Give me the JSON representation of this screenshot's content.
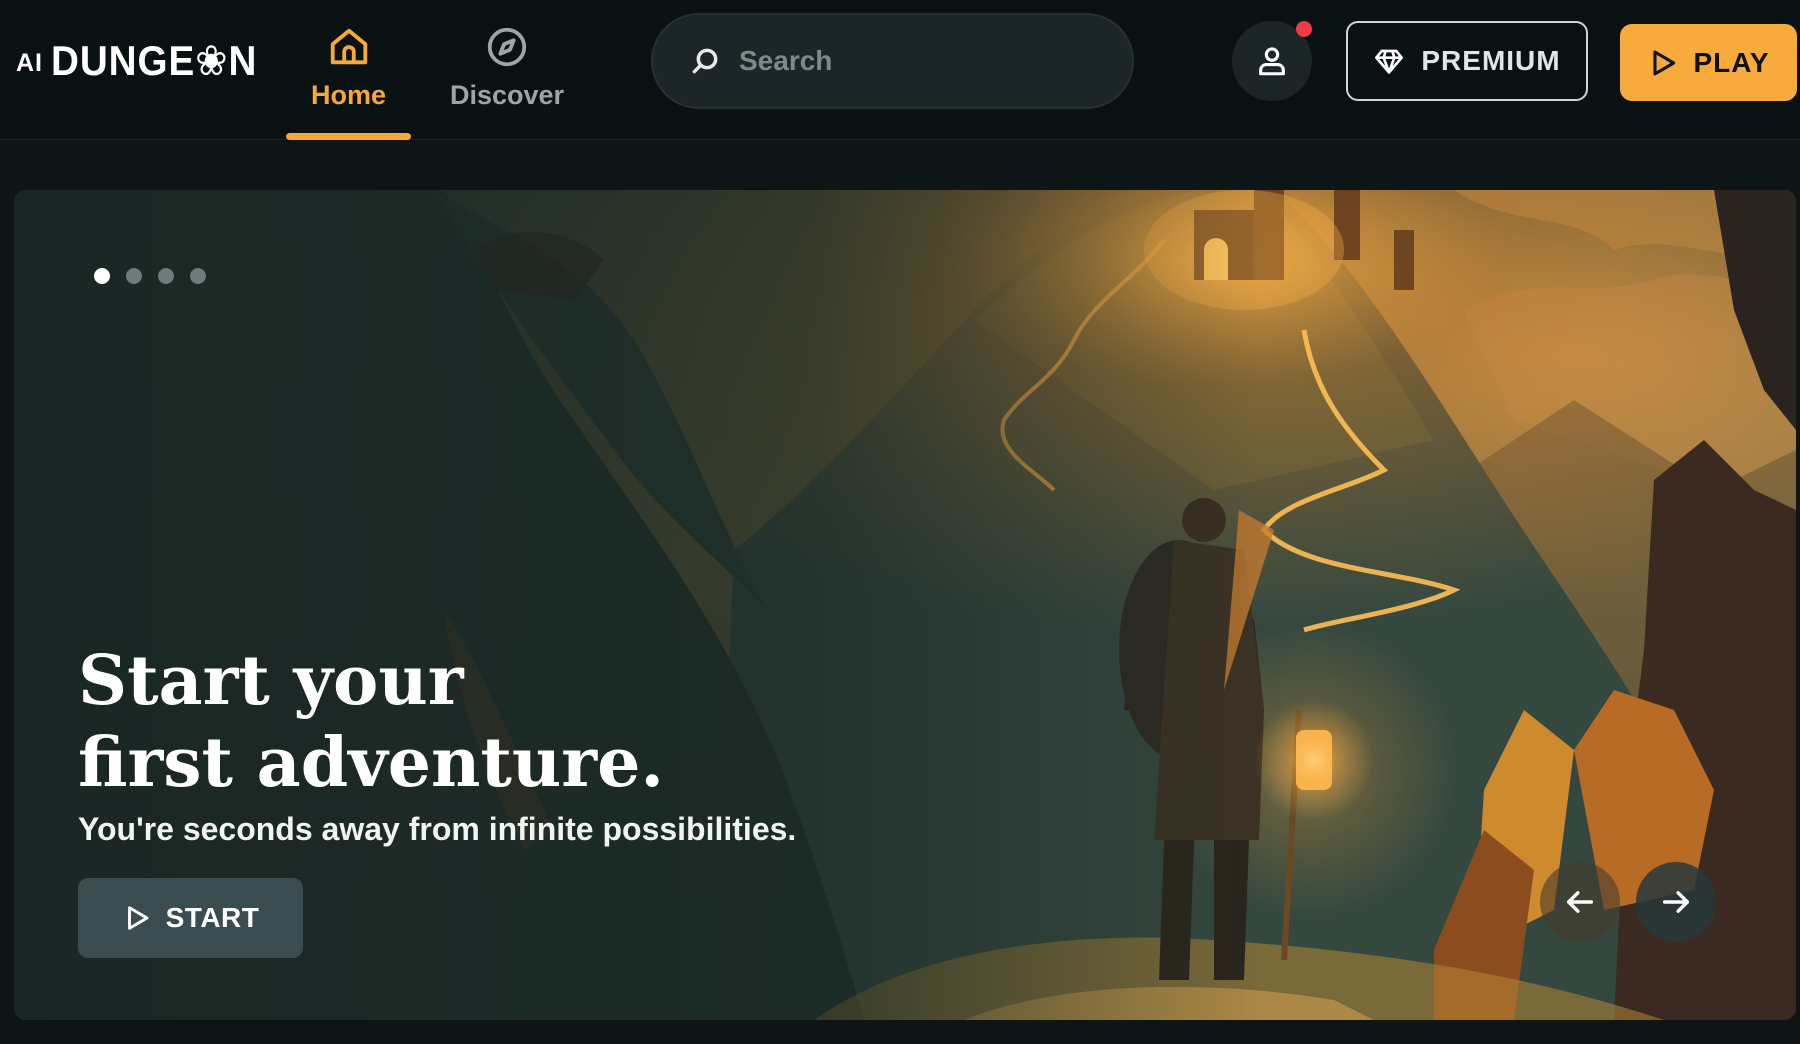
{
  "logo": {
    "prefix": "AI",
    "name": "DUNGE❀N"
  },
  "nav": {
    "tabs": [
      {
        "label": "Home",
        "icon": "home-icon",
        "active": true
      },
      {
        "label": "Discover",
        "icon": "compass-icon",
        "active": false
      }
    ]
  },
  "search": {
    "placeholder": "Search",
    "value": "",
    "icon": "search-icon"
  },
  "header_actions": {
    "profile_icon": "user-icon",
    "has_notification": true,
    "premium_label": "PREMIUM",
    "premium_icon": "diamond-icon",
    "play_label": "PLAY",
    "play_icon": "play-icon"
  },
  "hero": {
    "slides_count": 4,
    "active_slide": 1,
    "title_line1": "Start your",
    "title_line2": "first adventure.",
    "subtitle": "You're seconds away from infinite possibilities.",
    "start_label": "START",
    "start_icon": "play-icon",
    "prev_icon": "arrow-left-icon",
    "next_icon": "arrow-right-icon"
  },
  "colors": {
    "accent": "#f6ab3c",
    "background": "#0a1113",
    "notification": "#f03a47"
  }
}
